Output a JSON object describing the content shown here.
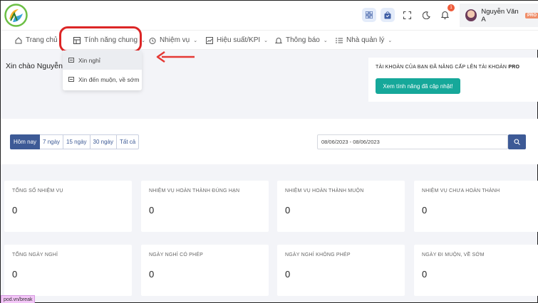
{
  "topbar": {
    "user_name": "Nguyễn Văn A",
    "pro_label": "PRO",
    "notification_count": "1",
    "icons": [
      "grid-icon",
      "shopping-bag-icon",
      "fullscreen-icon",
      "moon-icon",
      "bell-icon"
    ]
  },
  "nav": {
    "home": "Trang chủ",
    "features": "Tính năng chung",
    "tasks": "Nhiệm vụ",
    "kpi": "Hiệu suất/KPI",
    "notifications": "Thông báo",
    "manager": "Nhà quản lý"
  },
  "dropdown": {
    "items": [
      "Xin nghỉ",
      "Xin đến muộn, về sớm"
    ]
  },
  "greeting": "Xin chào Nguyễn",
  "upgrade": {
    "text_prefix": "TÀI KHOẢN CỦA BẠN ĐÃ NÂNG CẤP LÊN TÀI KHOẢN",
    "text_bold": "PRO",
    "button": "Xem tính năng đã cập nhật!"
  },
  "filters": {
    "ranges": [
      "Hôm nay",
      "7 ngày",
      "15 ngày",
      "30 ngày",
      "Tất cả"
    ],
    "active_range": "Hôm nay",
    "date_range": "08/06/2023 - 08/06/2023"
  },
  "stats_row1": [
    {
      "title": "TỔNG SỐ NHIỆM VỤ",
      "value": "0"
    },
    {
      "title": "NHIỆM VỤ HOÀN THÀNH ĐÚNG HẠN",
      "value": "0"
    },
    {
      "title": "NHIỆM VỤ HOÀN THÀNH MUỘN",
      "value": "0"
    },
    {
      "title": "NHIỆM VỤ CHƯA HOÀN THÀNH",
      "value": "0"
    }
  ],
  "stats_row2": [
    {
      "title": "TỔNG NGÀY NGHỈ",
      "value": "0"
    },
    {
      "title": "NGÀY NGHỈ CÓ PHÉP",
      "value": "0"
    },
    {
      "title": "NGÀY NGHỈ KHÔNG PHÉP",
      "value": "0"
    },
    {
      "title": "NGÀY ĐI MUỘN, VỀ SỚM",
      "value": "0"
    }
  ],
  "status_link": "pod.vn/break",
  "colors": {
    "primary": "#3d5a96",
    "teal": "#16a89a",
    "highlight": "#dc2626",
    "arrow": "#e53935"
  }
}
